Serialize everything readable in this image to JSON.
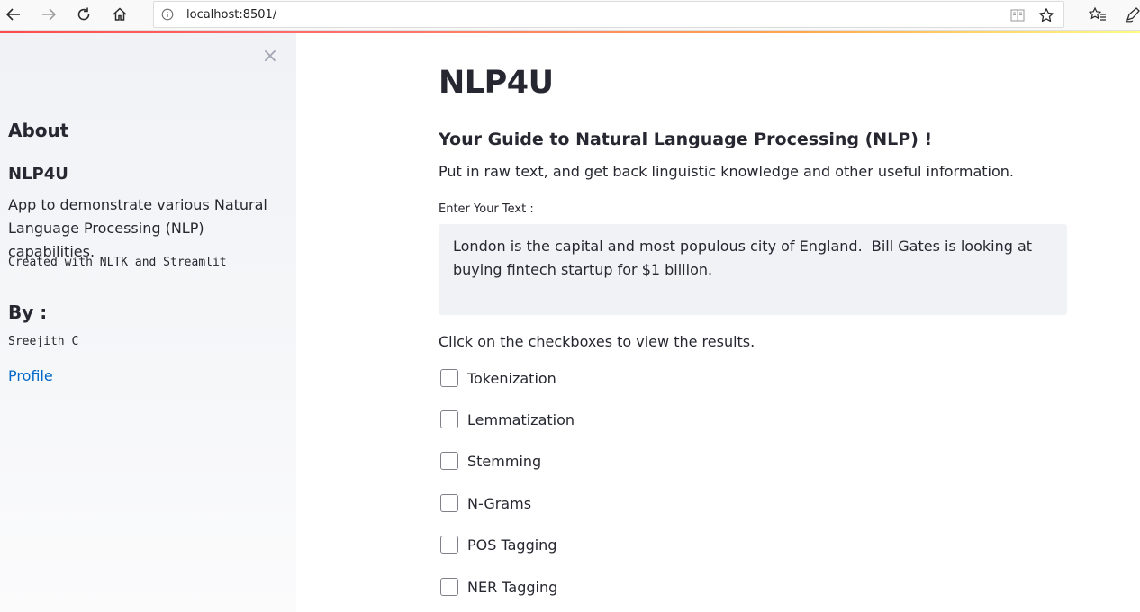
{
  "browser": {
    "url": "localhost:8501/",
    "icons": [
      "back-icon",
      "forward-icon",
      "reload-icon",
      "home-icon",
      "info-icon",
      "reader-view-icon",
      "bookmark-star-icon",
      "favorites-icon",
      "pen-icon"
    ]
  },
  "sidebar": {
    "close_glyph": "×",
    "about_heading": "About",
    "app_name": "NLP4U",
    "description": "App to demonstrate various Natural Language Processing (NLP) capabilities.",
    "created_with": "Created with NLTK and Streamlit",
    "by_heading": "By :",
    "author": "Sreejith C",
    "profile_link": "Profile"
  },
  "main": {
    "title": "NLP4U",
    "subtitle": "Your Guide to Natural Language Processing (NLP) !",
    "intro": "Put in raw text, and get back linguistic knowledge and other useful information.",
    "input_label": "Enter Your Text :",
    "input_value": "London is the capital and most populous city of England.  Bill Gates is looking at buying fintech startup for $1 billion.",
    "checkbox_prompt": "Click on the checkboxes to view the results.",
    "checkboxes": [
      {
        "label": "Tokenization",
        "checked": false
      },
      {
        "label": "Lemmatization",
        "checked": false
      },
      {
        "label": "Stemming",
        "checked": false
      },
      {
        "label": "N-Grams",
        "checked": false
      },
      {
        "label": "POS Tagging",
        "checked": false
      },
      {
        "label": "NER Tagging",
        "checked": false
      }
    ]
  },
  "colors": {
    "accent": "#ff4b4b",
    "link": "#0068c9",
    "sidebar_bg": "#f0f2f6",
    "text": "#262730"
  }
}
